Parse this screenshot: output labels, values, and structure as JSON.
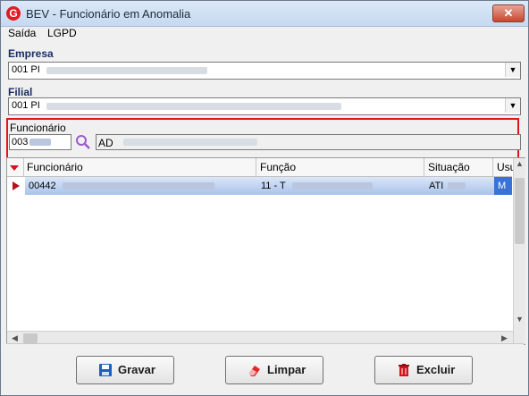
{
  "window": {
    "title": "BEV - Funcionário em Anomalia",
    "close_label": "✕"
  },
  "menu": [
    {
      "label": "Saída",
      "accel": "S"
    },
    {
      "label": "LGPD",
      "accel": "L"
    }
  ],
  "empresa": {
    "label": "Empresa",
    "value": "001 PI"
  },
  "filial": {
    "label": "Filial",
    "value": "001 PI"
  },
  "funcionario": {
    "label": "Funcionário",
    "code": "003",
    "name": "AD"
  },
  "grid": {
    "columns": [
      "Funcionário",
      "Função",
      "Situação",
      "Usu"
    ],
    "rows": [
      {
        "funcionario": "00442",
        "funcao": "11 - T",
        "situacao": "ATI",
        "usuario": "M"
      }
    ]
  },
  "buttons": {
    "gravar": "Gravar",
    "limpar": "Limpar",
    "excluir": "Excluir"
  },
  "colors": {
    "highlight": "#e0141a",
    "selection": "#a8c3ec"
  }
}
